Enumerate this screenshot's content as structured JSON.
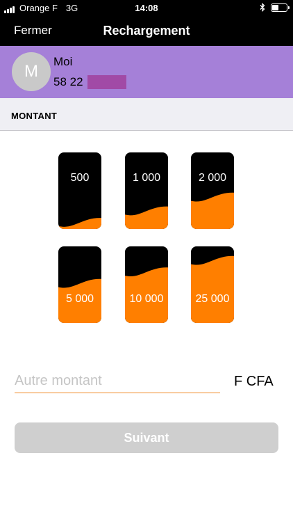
{
  "status_bar": {
    "carrier": "Orange F",
    "network": "3G",
    "time": "14:08",
    "bluetooth_icon": "bluetooth-icon",
    "battery_level": 0.4
  },
  "nav": {
    "close_label": "Fermer",
    "title": "Rechargement"
  },
  "contact": {
    "avatar_letter": "M",
    "name": "Moi",
    "phone_visible": "58 22",
    "background_color": "#a580d8"
  },
  "section": {
    "title": "MONTANT"
  },
  "amounts": [
    {
      "label": "500",
      "fill_level": 0.12
    },
    {
      "label": "1 000",
      "fill_level": 0.27
    },
    {
      "label": "2 000",
      "fill_level": 0.45
    },
    {
      "label": "5 000",
      "fill_level": 0.55
    },
    {
      "label": "10 000",
      "fill_level": 0.7
    },
    {
      "label": "25 000",
      "fill_level": 0.85
    }
  ],
  "other": {
    "placeholder": "Autre montant",
    "currency": "F CFA"
  },
  "next_button": {
    "label": "Suivant",
    "enabled": false
  },
  "colors": {
    "accent": "#ff7f00",
    "card": "#000000",
    "disabled_button": "#cfcfcf"
  }
}
